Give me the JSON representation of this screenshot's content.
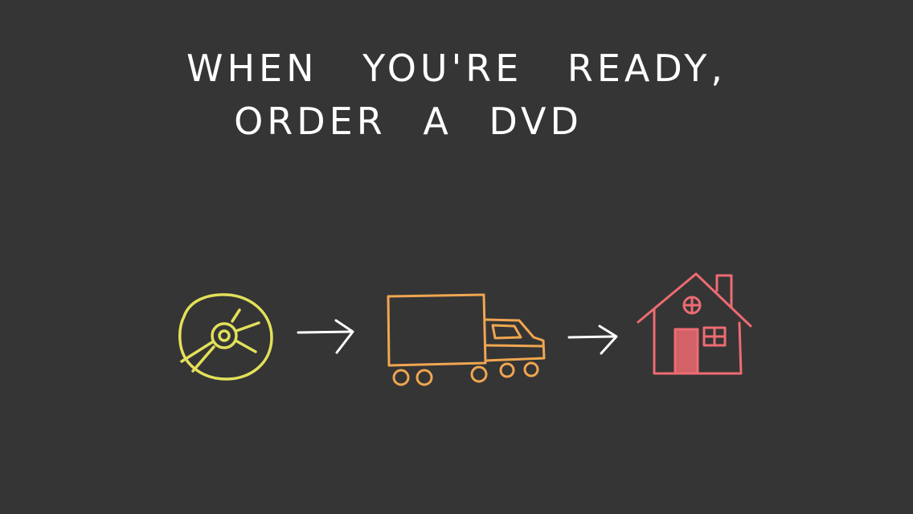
{
  "headline": {
    "line1": "When you're ready,",
    "line2": "order a DVD"
  },
  "illustration": {
    "steps": [
      "dvd-disc-icon",
      "delivery-truck-icon",
      "house-icon"
    ],
    "colors": {
      "background": "#353535",
      "text": "#ffffff",
      "disc": "#e3e05a",
      "arrow": "#ffffff",
      "truck": "#f0a650",
      "house": "#ee6b72"
    }
  }
}
